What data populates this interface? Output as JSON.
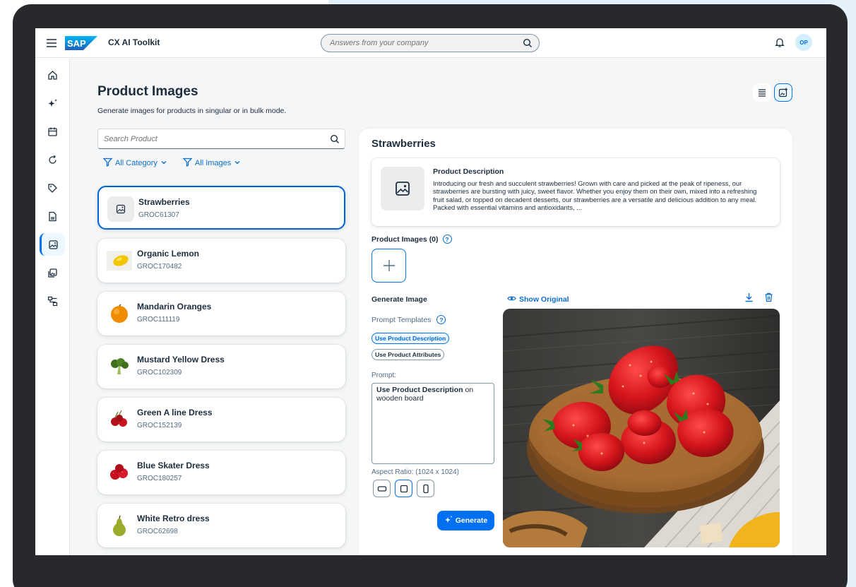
{
  "shell": {
    "app_title": "CX AI Toolkit",
    "search_placeholder": "Answers from your company",
    "avatar_initials": "OP"
  },
  "sidenav": {
    "items": [
      "home-icon",
      "ai-sparkle-icon",
      "calendar-icon",
      "refresh-icon",
      "tag-icon",
      "document-icon",
      "image-icon",
      "gallery-icon",
      "workflow-icon"
    ],
    "active": "image-icon"
  },
  "page": {
    "title": "Product Images",
    "subtitle": "Generate images for products in singular or in bulk mode."
  },
  "list": {
    "search_placeholder": "Search Product",
    "filter_category": "All Category",
    "filter_images": "All Images",
    "products": [
      {
        "name": "Strawberries",
        "code": "GROC61307",
        "thumb": "placeholder-image-icon"
      },
      {
        "name": "Organic Lemon",
        "code": "GROC170482",
        "thumb": "lemon-icon"
      },
      {
        "name": "Mandarin Oranges",
        "code": "GROC111119",
        "thumb": "orange-icon"
      },
      {
        "name": "Mustard Yellow Dress",
        "code": "GROC102309",
        "thumb": "broccoli-icon"
      },
      {
        "name": "Green A line Dress",
        "code": "GROC152139",
        "thumb": "cherries-icon"
      },
      {
        "name": "Blue Skater Dress",
        "code": "GROC180257",
        "thumb": "raspberries-icon"
      },
      {
        "name": "White Retro dress",
        "code": "GROC62698",
        "thumb": "pear-icon"
      }
    ]
  },
  "detail": {
    "title": "Strawberries",
    "desc_heading": "Product Description",
    "desc_text": "Introducing our fresh and succulent strawberries! Grown with care and picked at the peak of ripeness, our strawberries are bursting with juicy, sweet flavor. Whether you enjoy them on their own, mixed into a refreshing fruit salad, or topped on decadent desserts, our strawberries are a versatile and delicious addition to any meal. Packed with essential vitamins and antioxidants, ...",
    "images_label": "Product Images (0)",
    "generate_heading": "Generate Image",
    "prompt_templates_label": "Prompt Templates",
    "chip_description": "Use Product Description",
    "chip_attributes": "Use Product Attributes",
    "prompt_label": "Prompt:",
    "prompt_bold": "Use Product Description",
    "prompt_rest": " on wooden board",
    "aspect_label": "Aspect Ratio: (1024 x 1024)",
    "generate_label": "Generate",
    "show_original_label": "Show Original"
  },
  "colors": {
    "accent": "#0070f2",
    "link": "#0a6ed1",
    "text": "#1d2d3e",
    "muted": "#556b82"
  }
}
